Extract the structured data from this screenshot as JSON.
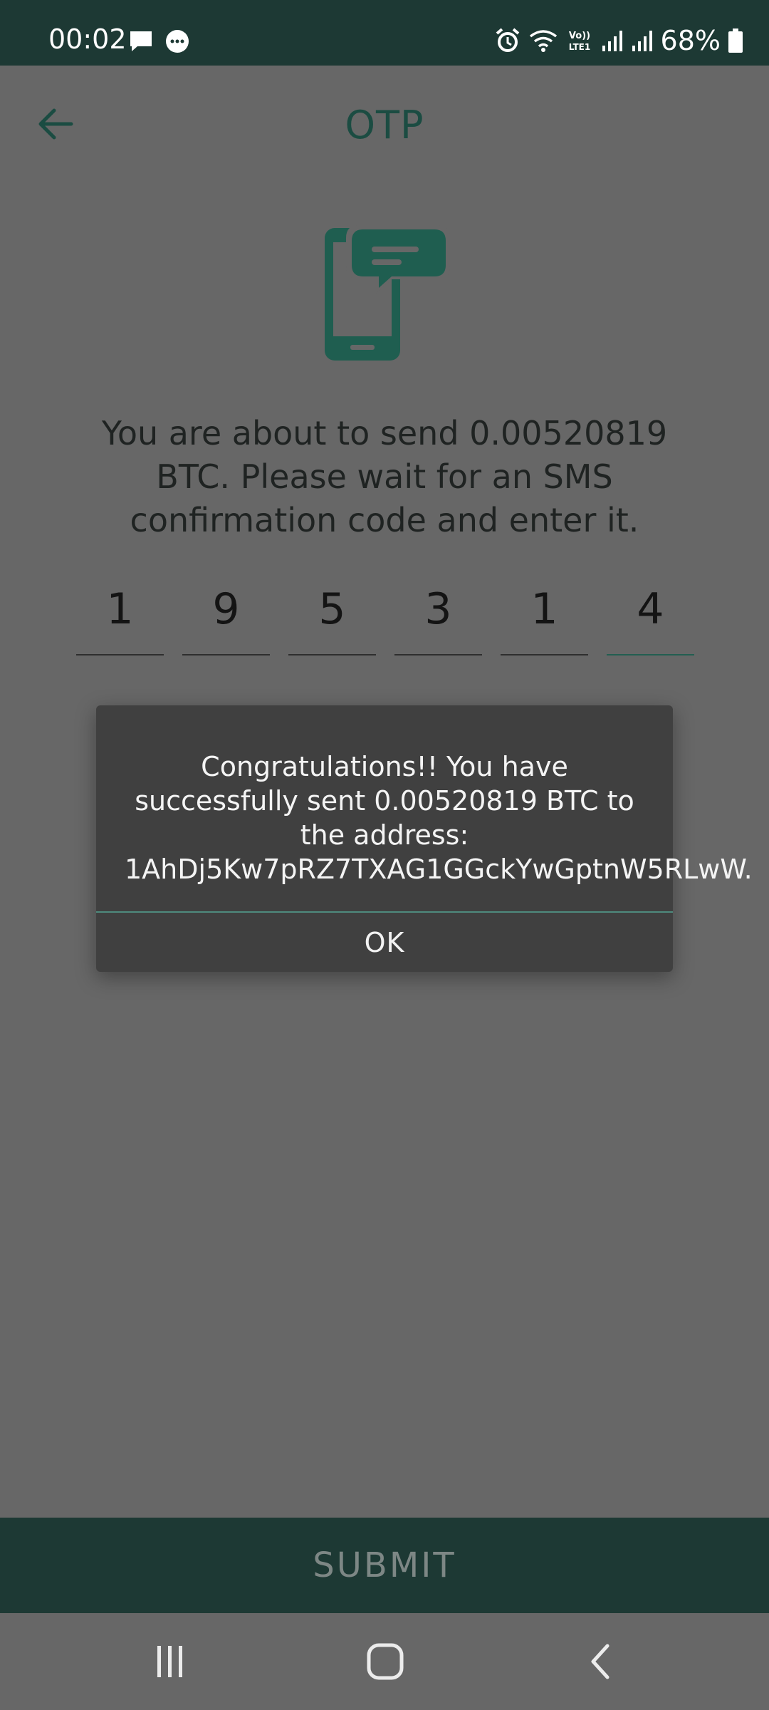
{
  "status_bar": {
    "time": "00:02",
    "battery": "68%",
    "left_icons": [
      "message-icon",
      "chat-bubble-icon"
    ],
    "right_icons": [
      "alarm-icon",
      "wifi-icon",
      "volte-lte-icon",
      "signal-icon",
      "signal-icon",
      "battery-icon"
    ],
    "volte_label": "Vo)) LTE1"
  },
  "header": {
    "title": "OTP",
    "back_icon": "arrow-left-icon"
  },
  "illustration": {
    "icon": "phone-sms-icon",
    "color": "#1f5e50"
  },
  "message": "You are about to send 0.00520819 BTC. Please wait for an SMS confirmation code and enter it.",
  "otp": {
    "digits": [
      "1",
      "9",
      "5",
      "3",
      "1",
      "4"
    ],
    "active_index": 5
  },
  "dialog": {
    "message": "Congratulations!! You have successfully sent 0.00520819 BTC to the address: 1AhDj5Kw7pRZ7TXAG1GGckYwGptnW5RLwW.",
    "ok_label": "OK"
  },
  "submit": {
    "label": "SUBMIT"
  },
  "nav_bar": {
    "icons": [
      "recent-apps-icon",
      "home-icon",
      "back-icon"
    ]
  },
  "colors": {
    "accent": "#1d3934",
    "scrim": "#676767",
    "dialog_bg": "#404040"
  }
}
